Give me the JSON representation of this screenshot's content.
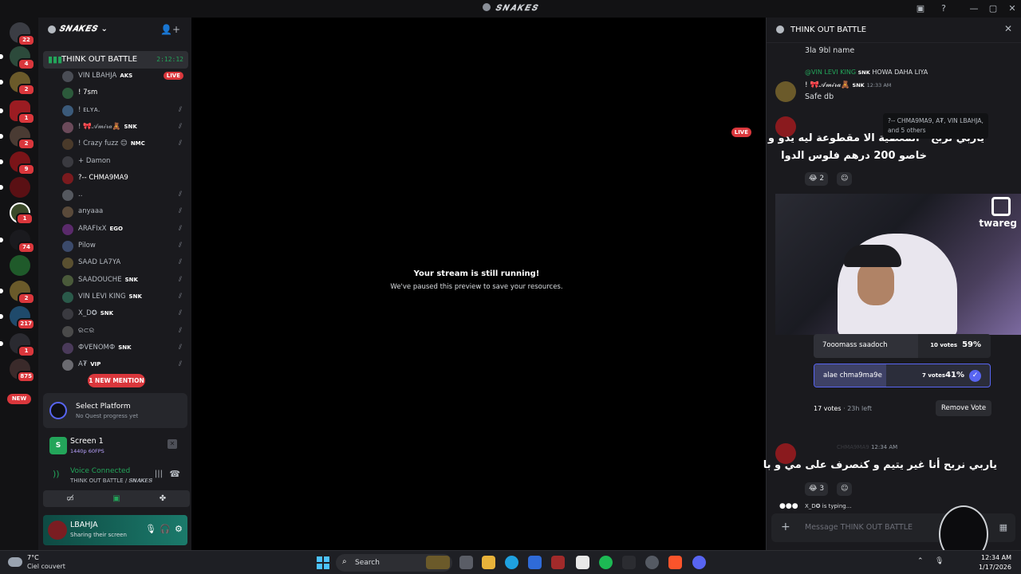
{
  "window": {
    "title": "𝑺𝑵𝑨𝑲𝑬𝑺"
  },
  "rail": {
    "badges": [
      "22",
      "4",
      "2",
      "1",
      "2",
      "9",
      "1",
      "74",
      "2",
      "217",
      "1",
      "875"
    ],
    "new_label": "NEW"
  },
  "server": {
    "name": "𝑺𝑵𝑨𝑲𝑬𝑺",
    "voice_channel": {
      "name": "THINK OUT BATTLE",
      "timer": "2:12:12"
    },
    "members": [
      {
        "name": "VIN LBAHJA",
        "tag": "AKS",
        "live": "LIVE",
        "color": "#b5bac1"
      },
      {
        "name": "! 7sm",
        "tag": "",
        "color": "#ffffff"
      },
      {
        "name": "! ᴇʟʏᴀ.",
        "tag": "",
        "color": "#b5bac1"
      },
      {
        "name": "! 🎀𝒜𝓂𝒾𝓇𝒶🧸",
        "tag": "SNK",
        "color": "#b5bac1"
      },
      {
        "name": "! Crazy fuzz 😊",
        "tag": "NMC",
        "color": "#b5bac1"
      },
      {
        "name": "+ Damon",
        "tag": "",
        "color": "#b5bac1"
      },
      {
        "name": "?-- CHMA9MA9",
        "tag": "",
        "color": "#ffffff"
      },
      {
        "name": "..",
        "tag": "",
        "color": "#b5bac1"
      },
      {
        "name": "anyaaa",
        "tag": "",
        "color": "#b5bac1"
      },
      {
        "name": "ARAFIxX",
        "tag": "EGO",
        "color": "#b5bac1"
      },
      {
        "name": "Pilow",
        "tag": "",
        "color": "#b5bac1"
      },
      {
        "name": "SAAD LA7YA",
        "tag": "",
        "color": "#b5bac1"
      },
      {
        "name": "SAADOUCHE",
        "tag": "SNK",
        "color": "#b5bac1"
      },
      {
        "name": "VIN LEVI KING",
        "tag": "SNK",
        "color": "#b5bac1"
      },
      {
        "name": "X_D✪",
        "tag": "SNK",
        "color": "#b5bac1"
      },
      {
        "name": "ର⊂ର",
        "tag": "",
        "color": "#b5bac1"
      },
      {
        "name": "ФVENOMФ",
        "tag": "SNK",
        "color": "#b5bac1"
      },
      {
        "name": "A₮",
        "tag": "VIP",
        "color": "#b5bac1"
      }
    ],
    "mention_pill": "1 NEW MENTION"
  },
  "quest": {
    "title": "Select Platform",
    "subtitle": "No Quest progress yet"
  },
  "screen_share": {
    "title": "Screen 1",
    "quality": "1440p 60FPS"
  },
  "voice_status": {
    "title": "Voice Connected",
    "channel": "THINK OUT BATTLE / 𝑺𝑵𝑨𝑲𝑬𝑺"
  },
  "user": {
    "name": "LBAHJA",
    "status": "Sharing their screen"
  },
  "stream": {
    "live_badge": "LIVE",
    "paused_title": "Your stream is still running!",
    "paused_subtitle": "We've paused this preview to save your resources."
  },
  "chat": {
    "title": "THINK OUT BATTLE",
    "msg0": "3la 9bl name",
    "reply_author": "@VIN LEVI KING",
    "reply_tag": "SNK",
    "reply_text": "HOWA DAHA LIYA",
    "msg1_author": "! 🎀𝒜𝓂𝒾𝓇𝒶🧸",
    "msg1_tag": "SNK",
    "msg1_time": "12:33 AM",
    "msg1_text": "Safe db",
    "tooltip": "?-- CHMA9MA9, A₮, VIN LBAHJA, and 5 others",
    "arabic1_line1": "ياربي نربح - المعطية الا مقطوعة ليه يدو و",
    "arabic1_line2": "خاصو 200 درهم فلوس الدوا",
    "react1": "😂 2",
    "video_brand": "twareg",
    "poll": [
      {
        "label": "7ooomass saadoch",
        "votes": "10 votes",
        "pct": "59%"
      },
      {
        "label": "alae chma9ma9e",
        "votes": "7 votes",
        "pct": "41%"
      }
    ],
    "poll_total": "17 votes",
    "poll_left": "23h left",
    "remove_vote": "Remove Vote",
    "msg3_author": "CHMA9MA9",
    "msg3_time": "12:34 AM",
    "arabic2": "ياربي نربح أنا غير يتيم و كنصرف على مي و با",
    "react2": "😂 3",
    "typing": "X_D✪ is typing...",
    "input_placeholder": "Message THINK OUT BATTLE"
  },
  "taskbar": {
    "temp": "7°C",
    "condition": "Ciel couvert",
    "search_label": "Search",
    "time": "12:34 AM",
    "date": "1/17/2026"
  }
}
